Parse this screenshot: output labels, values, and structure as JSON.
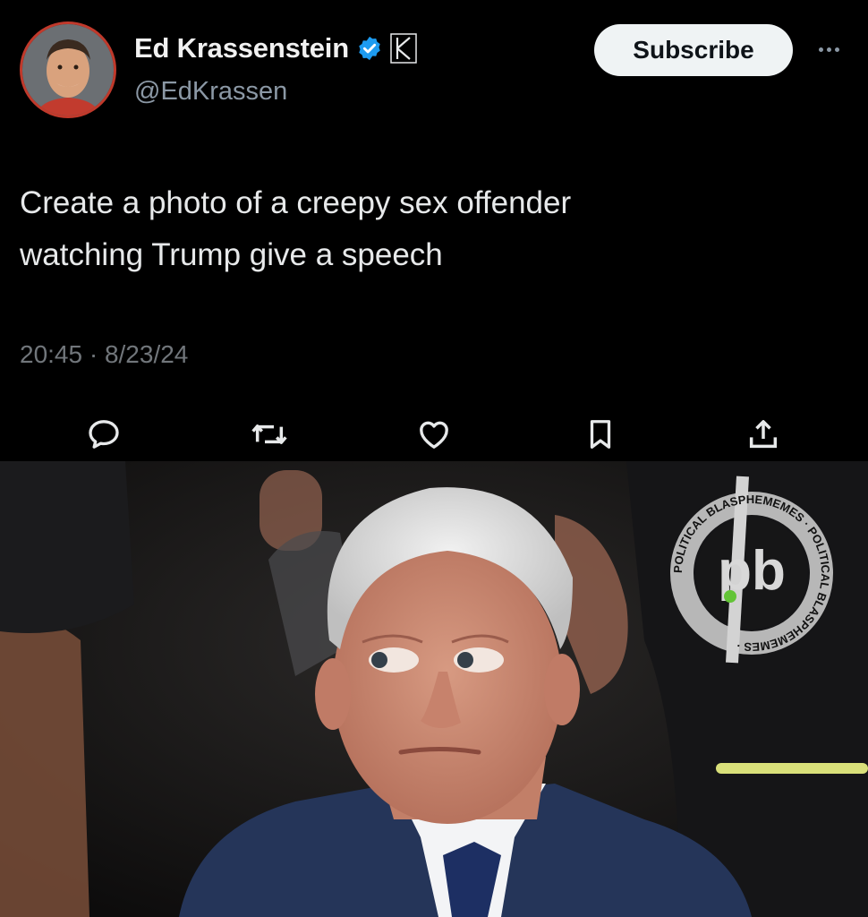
{
  "author": {
    "display_name": "Ed Krassenstein",
    "handle": "@EdKrassen"
  },
  "header": {
    "subscribe_label": "Subscribe"
  },
  "tweet": {
    "text": "Create a photo of a creepy sex offender\nwatching Trump give a speech",
    "timestamp": "20:45 · 8/23/24"
  },
  "actions": [
    {
      "icon": "reply-icon"
    },
    {
      "icon": "retweet-icon"
    },
    {
      "icon": "like-icon"
    },
    {
      "icon": "bookmark-icon"
    },
    {
      "icon": "share-icon"
    }
  ],
  "watermark": {
    "logo": "pb",
    "ring_text": "POLITICAL BLASPHEMEMES"
  },
  "colors": {
    "background": "#000000",
    "verified_blue": "#1d9bf0",
    "subscribe_bg": "#eff3f4",
    "secondary_text": "#71767b",
    "avatar_ring": "#c0392b"
  }
}
